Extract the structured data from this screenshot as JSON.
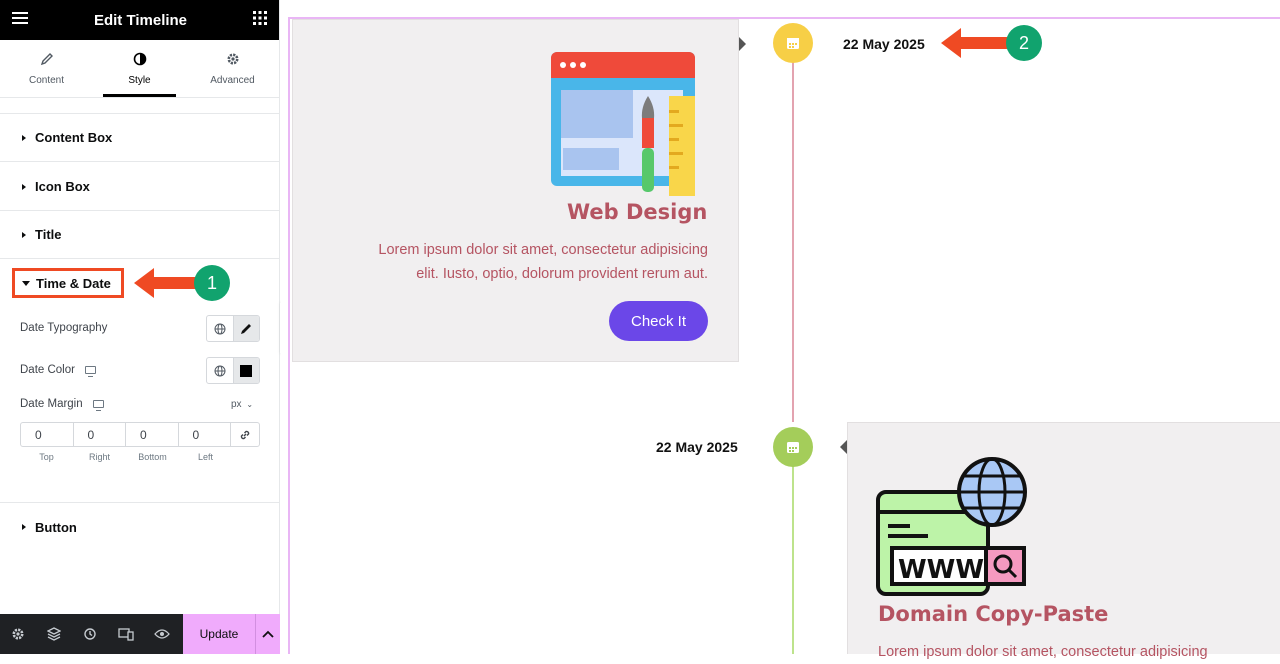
{
  "panel": {
    "title": "Edit Timeline",
    "tabs": [
      {
        "label": "Content",
        "icon": "pencil-icon"
      },
      {
        "label": "Style",
        "icon": "contrast-icon"
      },
      {
        "label": "Advanced",
        "icon": "gear-icon"
      }
    ],
    "sections": [
      "Content Box",
      "Icon Box",
      "Title",
      "Time & Date",
      "Button"
    ],
    "time_date": {
      "date_typography_label": "Date Typography",
      "date_color_label": "Date Color",
      "date_color_value": "#000000",
      "date_margin_label": "Date Margin",
      "margin_unit": "px",
      "margin_values": [
        "0",
        "0",
        "0",
        "0"
      ],
      "margin_labels": [
        "Top",
        "Right",
        "Bottom",
        "Left"
      ]
    },
    "footer": {
      "update_label": "Update"
    }
  },
  "annotations": {
    "badge1": "1",
    "badge2": "2",
    "arrow_color": "#ef4a23",
    "badge_color": "#11a36e"
  },
  "timeline": {
    "items": [
      {
        "date": "22 May 2025",
        "title": "Web Design",
        "text_line1": "Lorem ipsum dolor sit amet, consectetur adipisicing",
        "text_line2": "elit. Iusto, optio, dolorum provident rerum aut.",
        "button_label": "Check It",
        "dot_color": "#f7cf46"
      },
      {
        "date": "22 May 2025",
        "title": "Domain Copy-Paste",
        "text_line1": "Lorem ipsum dolor sit amet, consectetur adipisicing",
        "dot_color": "#a4cd5a"
      }
    ],
    "accent_color": "#b55462",
    "button_color": "#6b47e8"
  }
}
